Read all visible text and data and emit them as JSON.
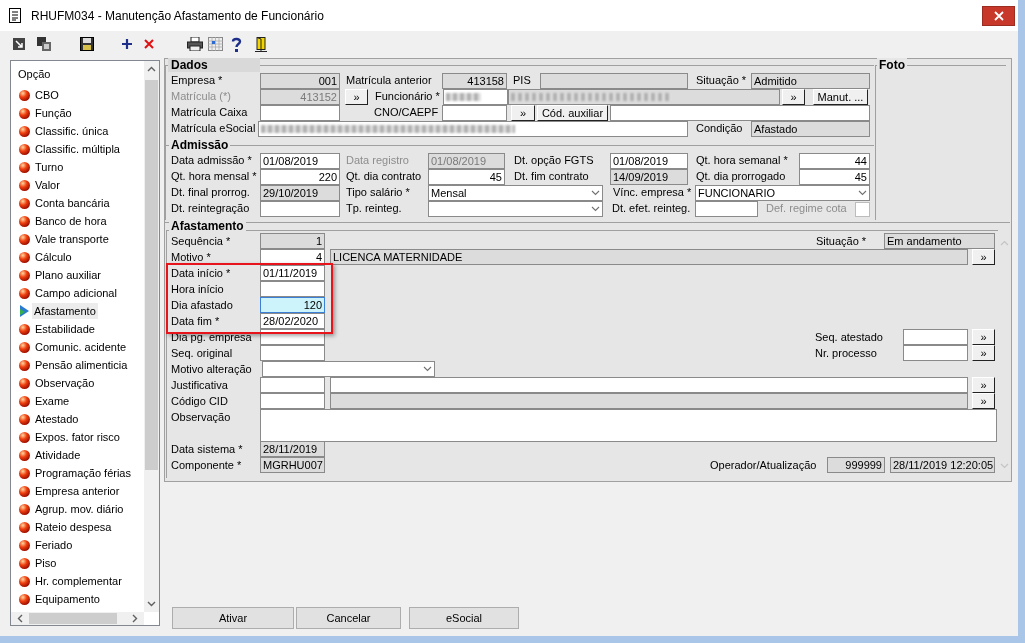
{
  "window": {
    "title": "RHUFM034 - Manutenção Afastamento de Funcionário"
  },
  "sidebar": {
    "header": "Opção",
    "items": [
      {
        "label": "CBO",
        "selected": false
      },
      {
        "label": "Função",
        "selected": false
      },
      {
        "label": "Classific. única",
        "selected": false
      },
      {
        "label": "Classific. múltipla",
        "selected": false
      },
      {
        "label": "Turno",
        "selected": false
      },
      {
        "label": "Valor",
        "selected": false
      },
      {
        "label": "Conta bancária",
        "selected": false
      },
      {
        "label": "Banco de hora",
        "selected": false
      },
      {
        "label": "Vale transporte",
        "selected": false
      },
      {
        "label": "Cálculo",
        "selected": false
      },
      {
        "label": "Plano auxiliar",
        "selected": false
      },
      {
        "label": "Campo adicional",
        "selected": false
      },
      {
        "label": "Afastamento",
        "selected": true
      },
      {
        "label": "Estabilidade",
        "selected": false
      },
      {
        "label": "Comunic. acidente",
        "selected": false
      },
      {
        "label": "Pensão alimenticia",
        "selected": false
      },
      {
        "label": "Observação",
        "selected": false
      },
      {
        "label": "Exame",
        "selected": false
      },
      {
        "label": "Atestado",
        "selected": false
      },
      {
        "label": "Expos. fator risco",
        "selected": false
      },
      {
        "label": "Atividade",
        "selected": false
      },
      {
        "label": "Programação férias",
        "selected": false
      },
      {
        "label": "Empresa anterior",
        "selected": false
      },
      {
        "label": "Agrup. mov. diário",
        "selected": false
      },
      {
        "label": "Rateio despesa",
        "selected": false
      },
      {
        "label": "Feriado",
        "selected": false
      },
      {
        "label": "Piso",
        "selected": false
      },
      {
        "label": "Hr. complementar",
        "selected": false
      },
      {
        "label": "Equipamento",
        "selected": false
      }
    ]
  },
  "dados": {
    "title": "Dados",
    "elements": [
      {
        "kind": "label",
        "text": "Empresa *",
        "disabled": false
      },
      {
        "kind": "field",
        "value": "001",
        "readonly": true
      },
      {
        "kind": "label",
        "text": "Matrícula anterior",
        "disabled": false
      },
      {
        "kind": "field",
        "value": "413158",
        "readonly": true
      },
      {
        "kind": "label",
        "text": "PIS",
        "disabled": false
      },
      {
        "kind": "field",
        "readonly": true
      },
      {
        "kind": "label",
        "text": "Situação *",
        "disabled": false
      },
      {
        "kind": "field",
        "value": "Admitido",
        "readonly": true
      },
      {
        "kind": "label",
        "text": "Matrícula (*)",
        "disabled": true
      },
      {
        "kind": "field",
        "value": "413152",
        "readonly": true,
        "disabled": true
      },
      {
        "kind": "button",
        "text": "»"
      },
      {
        "kind": "label",
        "text": "Funcionário *",
        "disabled": false
      },
      {
        "kind": "redacted",
        "readonly": false
      },
      {
        "kind": "redacted",
        "readonly": true
      },
      {
        "kind": "button",
        "text": "»"
      },
      {
        "kind": "button",
        "text": "Manut. ..."
      },
      {
        "kind": "label",
        "text": "Matrícula Caixa",
        "disabled": false
      },
      {
        "kind": "field",
        "readonly": false
      },
      {
        "kind": "label",
        "text": "CNO/CAEPF",
        "disabled": false
      },
      {
        "kind": "field",
        "readonly": false
      },
      {
        "kind": "button",
        "text": "»"
      },
      {
        "kind": "button",
        "text": "Cód. auxiliar"
      },
      {
        "kind": "field",
        "readonly": false
      },
      {
        "kind": "label",
        "text": "Matrícula eSocial",
        "disabled": false
      },
      {
        "kind": "redacted",
        "readonly": false
      },
      {
        "kind": "label",
        "text": "Condição",
        "disabled": false
      },
      {
        "kind": "field",
        "value": "Afastado",
        "readonly": true
      }
    ]
  },
  "admissao": {
    "title": "Admissão",
    "elements": [
      {
        "kind": "label",
        "text": "Data admissão *",
        "disabled": false
      },
      {
        "kind": "field",
        "value": "01/08/2019",
        "readonly": false
      },
      {
        "kind": "label",
        "text": "Data registro",
        "disabled": true
      },
      {
        "kind": "field",
        "value": "01/08/2019",
        "readonly": true,
        "disabled": true
      },
      {
        "kind": "label",
        "text": "Dt. opção FGTS",
        "disabled": false
      },
      {
        "kind": "field",
        "value": "01/08/2019",
        "readonly": false
      },
      {
        "kind": "label",
        "text": "Qt. hora semanal *",
        "disabled": false
      },
      {
        "kind": "field",
        "value": "44",
        "readonly": false
      },
      {
        "kind": "label",
        "text": "Qt. hora mensal *",
        "disabled": false
      },
      {
        "kind": "field",
        "value": "220",
        "readonly": false
      },
      {
        "kind": "label",
        "text": "Qt. dia contrato",
        "disabled": false
      },
      {
        "kind": "field",
        "value": "45",
        "readonly": false
      },
      {
        "kind": "label",
        "text": "Dt. fim contrato",
        "disabled": false
      },
      {
        "kind": "field",
        "value": "14/09/2019",
        "readonly": true
      },
      {
        "kind": "label",
        "text": "Qt. dia prorrogado",
        "disabled": false
      },
      {
        "kind": "field",
        "value": "45",
        "readonly": false
      },
      {
        "kind": "label",
        "text": "Dt. final prorrog.",
        "disabled": false
      },
      {
        "kind": "field",
        "value": "29/10/2019",
        "readonly": true
      },
      {
        "kind": "label",
        "text": "Tipo salário *",
        "disabled": false
      },
      {
        "kind": "select",
        "value": "Mensal"
      },
      {
        "kind": "label",
        "text": "Vínc. empresa *",
        "disabled": false
      },
      {
        "kind": "select",
        "value": "FUNCIONARIO"
      },
      {
        "kind": "label",
        "text": "Dt. reintegração",
        "disabled": false
      },
      {
        "kind": "field",
        "readonly": false
      },
      {
        "kind": "label",
        "text": "Tp. reinteg.",
        "disabled": false
      },
      {
        "kind": "select"
      },
      {
        "kind": "label",
        "text": "Dt. efet. reinteg.",
        "disabled": false
      },
      {
        "kind": "field",
        "readonly": false
      },
      {
        "kind": "label",
        "text": "Def. regime cota",
        "disabled": true
      },
      {
        "kind": "checkbox",
        "checked": false
      }
    ]
  },
  "foto": {
    "title": "Foto"
  },
  "afastamento": {
    "title": "Afastamento",
    "elements": [
      {
        "kind": "label",
        "text": "Sequência *",
        "disabled": false
      },
      {
        "kind": "field",
        "value": "1",
        "readonly": true
      },
      {
        "kind": "label",
        "text": "Situação *",
        "disabled": false
      },
      {
        "kind": "field",
        "value": "Em andamento",
        "readonly": true
      },
      {
        "kind": "label",
        "text": "Motivo *",
        "disabled": false
      },
      {
        "kind": "field",
        "value": "4",
        "readonly": false
      },
      {
        "kind": "field",
        "value": "LICENCA MATERNIDADE",
        "readonly": true
      },
      {
        "kind": "button",
        "text": "»"
      },
      {
        "kind": "label",
        "text": "Data início *",
        "disabled": false
      },
      {
        "kind": "field",
        "value": "01/11/2019",
        "readonly": false
      },
      {
        "kind": "label",
        "text": "Hora início",
        "disabled": false
      },
      {
        "kind": "field",
        "readonly": false
      },
      {
        "kind": "label",
        "text": "Dia afastado",
        "disabled": false
      },
      {
        "kind": "field",
        "value": "120",
        "readonly": false,
        "focused": true
      },
      {
        "kind": "label",
        "text": "Data fim *",
        "disabled": false
      },
      {
        "kind": "field",
        "value": "28/02/2020",
        "readonly": false
      },
      {
        "kind": "label",
        "text": "Dia pg. empresa",
        "disabled": false
      },
      {
        "kind": "field",
        "readonly": false
      },
      {
        "kind": "label",
        "text": "Seq. atestado",
        "disabled": false
      },
      {
        "kind": "field",
        "readonly": false
      },
      {
        "kind": "button",
        "text": "»"
      },
      {
        "kind": "label",
        "text": "Seq. original",
        "disabled": false
      },
      {
        "kind": "field",
        "readonly": false
      },
      {
        "kind": "label",
        "text": "Nr. processo",
        "disabled": false
      },
      {
        "kind": "field",
        "readonly": false
      },
      {
        "kind": "button",
        "text": "»"
      },
      {
        "kind": "label",
        "text": "Motivo alteração",
        "disabled": false
      },
      {
        "kind": "select"
      },
      {
        "kind": "label",
        "text": "Justificativa",
        "disabled": false
      },
      {
        "kind": "field",
        "readonly": false
      },
      {
        "kind": "field",
        "readonly": false
      },
      {
        "kind": "button",
        "text": "»"
      },
      {
        "kind": "label",
        "text": "Código CID",
        "disabled": false
      },
      {
        "kind": "field",
        "readonly": false
      },
      {
        "kind": "field",
        "readonly": true
      },
      {
        "kind": "button",
        "text": "»"
      },
      {
        "kind": "label",
        "text": "Observação",
        "disabled": false
      },
      {
        "kind": "textarea"
      },
      {
        "kind": "label",
        "text": "Data sistema *",
        "disabled": false
      },
      {
        "kind": "field",
        "value": "28/11/2019",
        "readonly": true
      },
      {
        "kind": "label",
        "text": "Componente *",
        "disabled": false
      },
      {
        "kind": "field",
        "value": "MGRHU007",
        "readonly": true
      },
      {
        "kind": "label",
        "text": "Operador/Atualização",
        "disabled": false
      },
      {
        "kind": "field",
        "value": "999999",
        "readonly": true
      },
      {
        "kind": "field",
        "value": "28/11/2019 12:20:05",
        "readonly": true
      }
    ]
  },
  "buttons": [
    "Ativar",
    "Cancelar",
    "eSocial"
  ]
}
